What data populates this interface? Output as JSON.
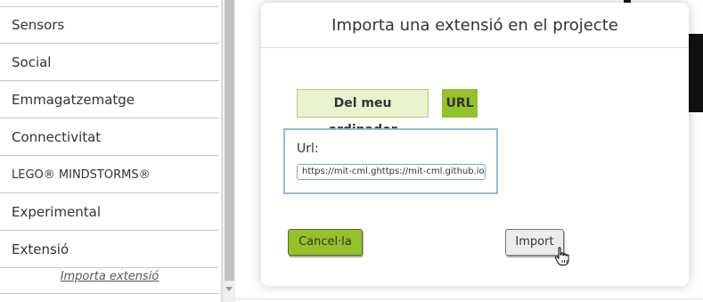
{
  "palette": {
    "items": [
      {
        "label": "Sensors"
      },
      {
        "label": "Social"
      },
      {
        "label": "Emmagatzematge"
      },
      {
        "label": "Connectivitat"
      },
      {
        "label": "LEGO® MINDSTORMS®"
      },
      {
        "label": "Experimental"
      },
      {
        "label": "Extensió"
      }
    ],
    "import_link": "Importa extensió"
  },
  "dialog": {
    "title": "Importa una extensió en el projecte",
    "tabs": {
      "from_computer": "Del meu ordinador",
      "url": "URL"
    },
    "url_label": "Url:",
    "url_value": "https://mit-cml.ghttps://mit-cml.github.io/exter",
    "cancel_label": "Cancel·la",
    "import_label": "Import"
  },
  "colors": {
    "accent_green": "#95c12a",
    "tab_light_green": "#e9f2cf",
    "url_box_border": "#93b9de"
  },
  "icons": {
    "cursor": "hand-pointer-icon"
  }
}
